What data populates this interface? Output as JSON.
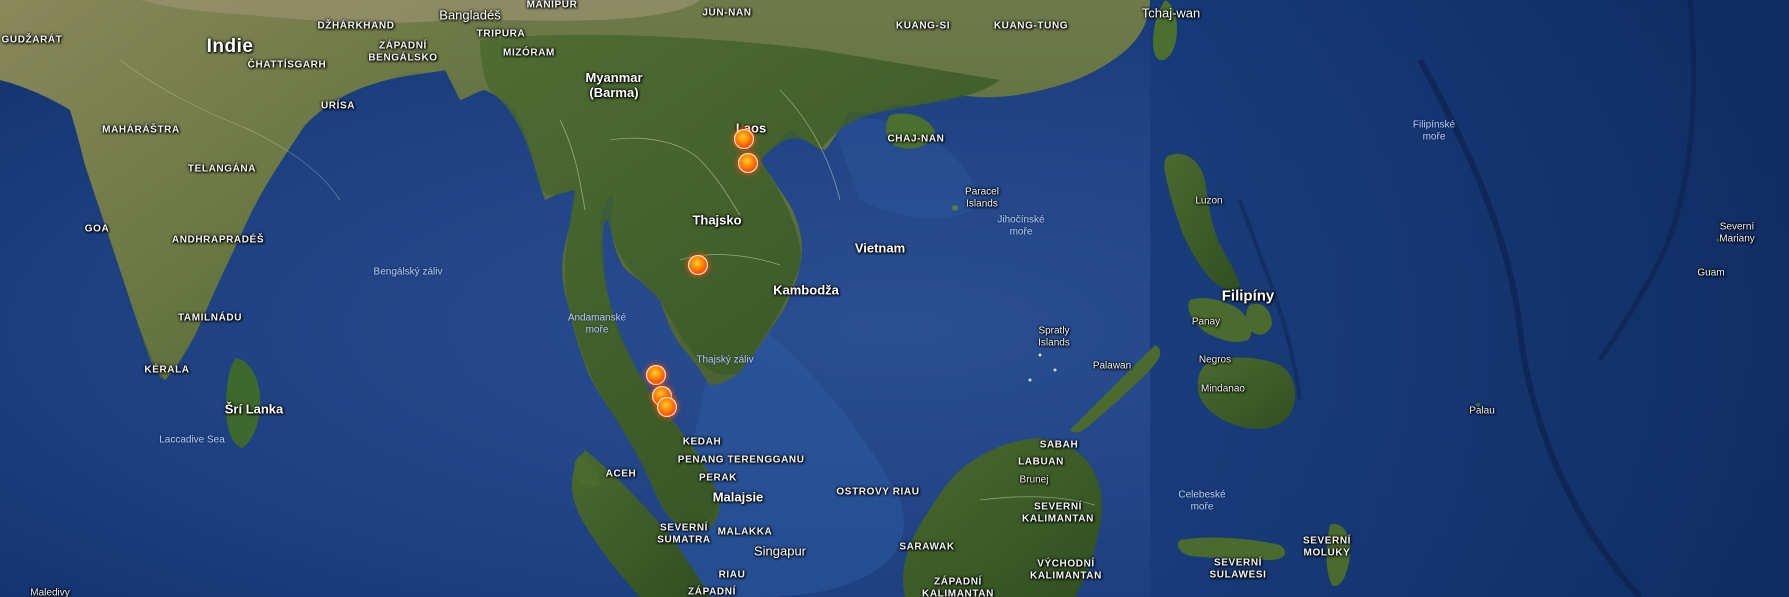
{
  "map": {
    "labels": {
      "indie": "Indie",
      "gudzarat": "GUDŽARÁT",
      "dzharkhand": "DŽHÁRKHAND",
      "zapadni_bengalsko": "ZÁPADNÍ\nBENGÁLSKO",
      "chattisgarh": "ČHATTÍSGARH",
      "urisa": "URÍSA",
      "maharastra": "MAHÁRÁŠTRA",
      "telangana": "TELANGÁNA",
      "goa": "GOA",
      "andhrapradesh": "ANDHRAPRADÉŠ",
      "tamilnadu": "TAMILNÁDU",
      "kerala": "KÉRALA",
      "sri_lanka": "Šrí Lanka",
      "laccadive_sea": "Laccadive Sea",
      "maledivy": "Maledivy",
      "bengalsky_zaliv": "Bengálský záliv",
      "banglades": "Bangladéš",
      "manipur": "MANIPUR",
      "tripura": "TRIPURA",
      "mizoram": "MIZÓRAM",
      "myanmar": "Myanmar\n(Barma)",
      "andamanske_more": "Andamanské\nmoře",
      "jun_nan": "JÜN-NAN",
      "kuang_si": "KUANG-SI",
      "kuang_tung": "KUANG-TUNG",
      "tchaj_wan": "Tchaj-wan",
      "chaj_nan": "CHAJ-NAN",
      "laos": "Laos",
      "thajsko": "Thajsko",
      "vietnam": "Vietnam",
      "kambodza": "Kambodža",
      "thajsky_zaliv": "Thajský záliv",
      "paracel": "Paracel\nIslands",
      "jihocinske_more": "Jihočínské\nmoře",
      "spratly": "Spratly\nIslands",
      "filipinske_more": "Filipínské\nmoře",
      "luzon": "Luzon",
      "filipiny": "Filipíny",
      "panay": "Panay",
      "negros": "Negros",
      "mindanao": "Mindanao",
      "palawan": "Palawan",
      "palau": "Palau",
      "guam": "Guam",
      "severni_mariany": "Severní\nMariany",
      "kedah": "KEDAH",
      "penang": "PENANG",
      "terengganu": "TERENGGANU",
      "perak": "PERAK",
      "malajsie": "Malajsie",
      "aceh": "ACEH",
      "severni_sumatra": "SEVERNÍ\nSUMATRA",
      "malakka": "MALAKKA",
      "singapur": "Singapur",
      "riau": "RIAU",
      "zapadni_s": "ZÁPADNÍ",
      "ostrovy_riau": "OSTROVY RIAU",
      "sarawak": "SARAWAK",
      "zapadni_kalimantan": "ZÁPADNÍ\nKALIMANTAN",
      "sabah": "SABAH",
      "labuan": "LABUAN",
      "brunej": "Brunej",
      "severni_kalimantan": "SEVERNÍ\nKALIMANTAN",
      "vychodni_kalimantan": "VÝCHODNÍ\nKALIMANTAN",
      "celebeske_more": "Celebeské\nmoře",
      "severni_sulawesi": "SEVERNÍ\nSULAWESI",
      "severni_moluky": "SEVERNÍ\nMOLUKY"
    },
    "colors": {
      "ocean": "#1b3d78",
      "ocean_deep": "#10285a",
      "land_green": "#3f5e2c",
      "land_light": "#6b7b46",
      "land_dry": "#8a8a5c",
      "marker_core": "#ff8a00",
      "marker_edge": "#d11f00"
    },
    "markers": [
      {
        "name": "Laos north"
      },
      {
        "name": "Laos south"
      },
      {
        "name": "Bangkok"
      },
      {
        "name": "Phuket north"
      },
      {
        "name": "Phuket"
      },
      {
        "name": "Krabi"
      }
    ]
  }
}
